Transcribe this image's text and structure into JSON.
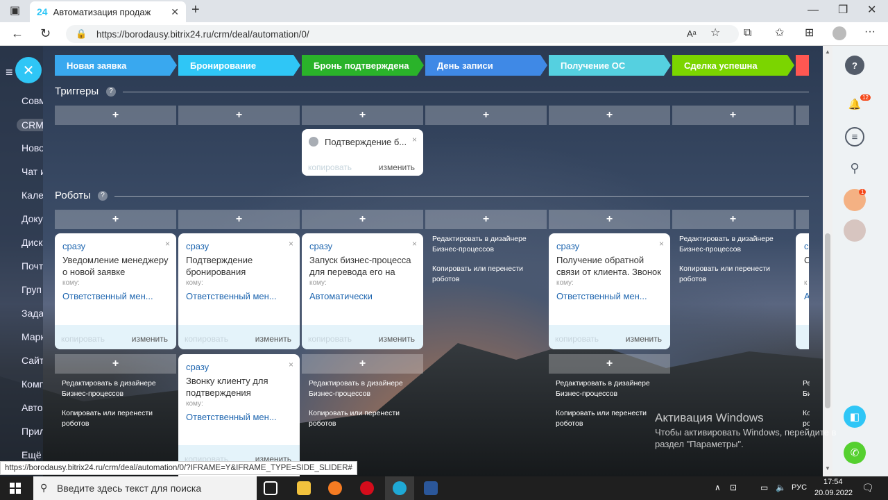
{
  "browser": {
    "tab_icon": "24",
    "tab_title": "Автоматизация продаж",
    "url": "https://borodausy.bitrix24.ru/crm/deal/automation/0/",
    "reader_label": "Aᵃ"
  },
  "leftnav": [
    "Совм",
    "CRM",
    "Ново",
    "Чат и",
    "Кале",
    "Доку",
    "Диск",
    "Почт",
    "Груп",
    "Зада",
    "Марк",
    "Сайт",
    "Комп",
    "Авто",
    "Прил",
    "Ещё"
  ],
  "stages": [
    {
      "label": "Новая заявка",
      "color": "#39a8ef"
    },
    {
      "label": "Бронирование",
      "color": "#2fc6f6"
    },
    {
      "label": "Бронь подтверждена",
      "color": "#2ab32a"
    },
    {
      "label": "День записи",
      "color": "#3f89e6"
    },
    {
      "label": "Получение ОС",
      "color": "#55d0e0"
    },
    {
      "label": "Сделка успешна",
      "color": "#7bd500"
    },
    {
      "label": "",
      "color": "#ff5752"
    }
  ],
  "triggers": {
    "title": "Триггеры",
    "help": "?",
    "add": "+",
    "card": {
      "title": "Подтверждение б...",
      "copy": "копировать",
      "edit": "изменить",
      "close": "×"
    }
  },
  "robots": {
    "title": "Роботы",
    "help": "?",
    "add": "+",
    "when": "сразу",
    "to": "кому:",
    "copy": "копировать",
    "edit": "изменить",
    "close": "×",
    "cards": [
      {
        "title": "Уведомление менеджеру о новой заявке",
        "resp": "Ответственный мен..."
      },
      {
        "title": "Подтверждение бронирования",
        "resp": "Ответственный мен..."
      },
      {
        "title": "Запуск бизнес-процесса для перевода его на",
        "resp": "Автоматически"
      },
      {
        "title": "Получение обратной связи от клиента. Звонок",
        "resp": "Ответственный мен..."
      },
      {
        "title": "Звонку клиенту для подтверждения",
        "resp": "Ответственный мен..."
      }
    ],
    "partial": {
      "when": "с",
      "title": "С",
      "to": "к",
      "resp": "А"
    },
    "ghost_edit": "Редактировать в дизайнере Бизнес-процессов",
    "ghost_copy": "Копировать или перенести роботов",
    "ghost_partial_edit": "Ре Би",
    "ghost_partial_copy": "Ко ро"
  },
  "rightbar": {
    "help": "?",
    "notif_count": "12",
    "avatar_badge": "1"
  },
  "statusbar": "https://borodausy.bitrix24.ru/crm/deal/automation/0/?IFRAME=Y&IFRAME_TYPE=SIDE_SLIDER#",
  "watermark": {
    "title": "Активация Windows",
    "text1": "Чтобы активировать Windows, перейдите в",
    "text2": "раздел \"Параметры\"."
  },
  "taskbar": {
    "search_placeholder": "Введите здесь текст для поиска",
    "lang": "РУС",
    "time": "17:54",
    "date": "20.09.2022"
  }
}
